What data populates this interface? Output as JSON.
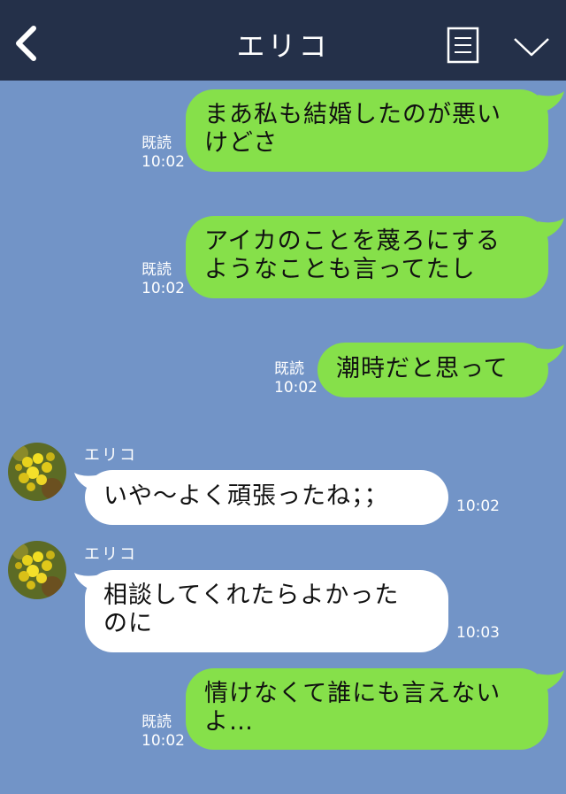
{
  "header": {
    "title": "エリコ"
  },
  "colors": {
    "header_bg": "#243049",
    "chat_bg": "#7294c7",
    "my_bubble": "#86e04a",
    "their_bubble": "#ffffff"
  },
  "icons": {
    "back": "chevron-left-icon",
    "note": "note-icon",
    "menu": "chevron-down-icon"
  },
  "messages": [
    {
      "from": "me",
      "text": "まあ私も結婚したのが悪い\nけどさ",
      "read_label": "既読",
      "time": "10:02"
    },
    {
      "from": "me",
      "text": "アイカのことを蔑ろにする\nようなことも言ってたし",
      "read_label": "既読",
      "time": "10:02"
    },
    {
      "from": "me",
      "text": "潮時だと思って",
      "read_label": "既読",
      "time": "10:02"
    },
    {
      "from": "them",
      "sender": "エリコ",
      "text": "いや〜よく頑張ったね；；",
      "time": "10:02"
    },
    {
      "from": "them",
      "sender": "エリコ",
      "text": "相談してくれたらよかった\nのに",
      "time": "10:03"
    },
    {
      "from": "me",
      "text": "情けなくて誰にも言えない\nよ…",
      "read_label": "既読",
      "time": "10:02"
    }
  ]
}
